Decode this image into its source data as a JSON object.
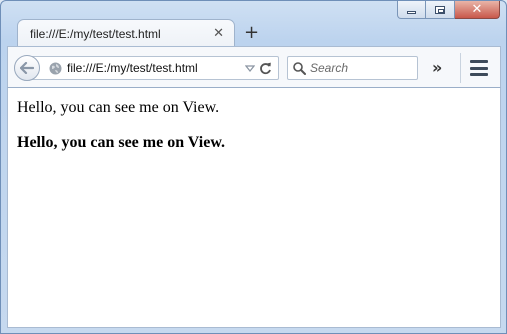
{
  "window": {
    "tab_title": "file:///E:/my/test/test.html",
    "tab_close_glyph": "✕",
    "new_tab_glyph": "+",
    "controls": {
      "minimize": "minimize-icon",
      "maximize": "restore-icon",
      "close_glyph": "✕"
    }
  },
  "toolbar": {
    "url": "file:///E:/my/test/test.html",
    "search_placeholder": "Search",
    "overflow_glyph": "»",
    "icons": [
      "back-arrow-icon",
      "globe-icon",
      "dropdown-triangle-icon",
      "reload-icon",
      "search-icon",
      "overflow-chevron-icon",
      "hamburger-menu-icon"
    ]
  },
  "content": {
    "line1": "Hello, you can see me on View.",
    "line2": "Hello, you can see me on View."
  },
  "colors": {
    "frame": "#c6d9ef",
    "close_button": "#c8584b",
    "toolbar": "#f6f8fb",
    "page": "#ffffff"
  }
}
